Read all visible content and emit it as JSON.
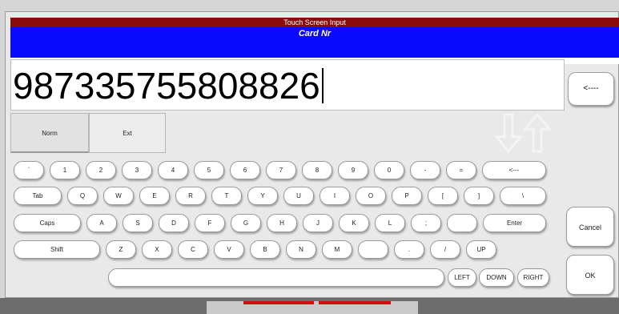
{
  "header": {
    "title": "Touch Screen Input",
    "field_name": "Card Nr"
  },
  "input": {
    "value": "987335755808826"
  },
  "tabs": [
    {
      "label": "Norm"
    },
    {
      "label": "Ext"
    }
  ],
  "backspace_label": "<----",
  "rows": [
    [
      "`",
      "1",
      "2",
      "3",
      "4",
      "5",
      "6",
      "7",
      "8",
      "9",
      "0",
      "-",
      "=",
      "<---"
    ],
    [
      "Tab",
      "Q",
      "W",
      "E",
      "R",
      "T",
      "Y",
      "U",
      "I",
      "O",
      "P",
      "[",
      "]",
      "\\"
    ],
    [
      "Caps",
      "A",
      "S",
      "D",
      "F",
      "G",
      "H",
      "J",
      "K",
      "L",
      ";",
      "",
      "Enter"
    ],
    [
      "Shift",
      "Z",
      "X",
      "C",
      "V",
      "B",
      "N",
      "M",
      "",
      ".",
      "/",
      "UP"
    ],
    [
      "",
      "LEFT",
      "DOWN",
      "RIGHT"
    ]
  ],
  "side": {
    "cancel": "Cancel",
    "ok": "OK"
  },
  "colors": {
    "title_bar": "#8a0c0c",
    "field_bar": "#0a0aff",
    "accent_red": "#d01010"
  },
  "icons": [
    "down-arrow-icon",
    "up-arrow-icon"
  ]
}
